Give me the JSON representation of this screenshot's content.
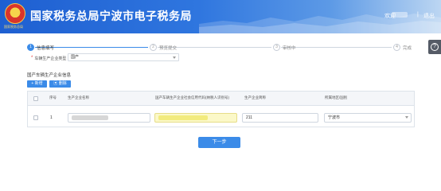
{
  "header": {
    "logo_text": "国家税务总局",
    "title": "国家税务总局宁波市电子税务局",
    "user_label": "欢迎",
    "separator": "|",
    "logout": "退出"
  },
  "steps": [
    {
      "index": "1",
      "label": "信息填写"
    },
    {
      "index": "2",
      "label": "预览提交"
    },
    {
      "index": "3",
      "label": "审核中"
    },
    {
      "index": "4",
      "label": "完成"
    }
  ],
  "form": {
    "required_mark": "*",
    "type_label": "车辆生产企业类型",
    "type_value": "国产"
  },
  "section": {
    "title": "国产车辆生产企业信息",
    "add_button": "+ 新增",
    "delete_button": "删除"
  },
  "table": {
    "headers": {
      "index": "序号",
      "name": "生产企业名称",
      "credit_code": "国产车辆生产企业社会信用代码(纳税人识别号)",
      "short_name": "生产企业简称",
      "region": "所属地区/国别"
    },
    "rows": [
      {
        "index": "1",
        "name": "",
        "credit_code": "",
        "short_name": "211",
        "region": "宁波市"
      }
    ]
  },
  "next_button": "下一步"
}
